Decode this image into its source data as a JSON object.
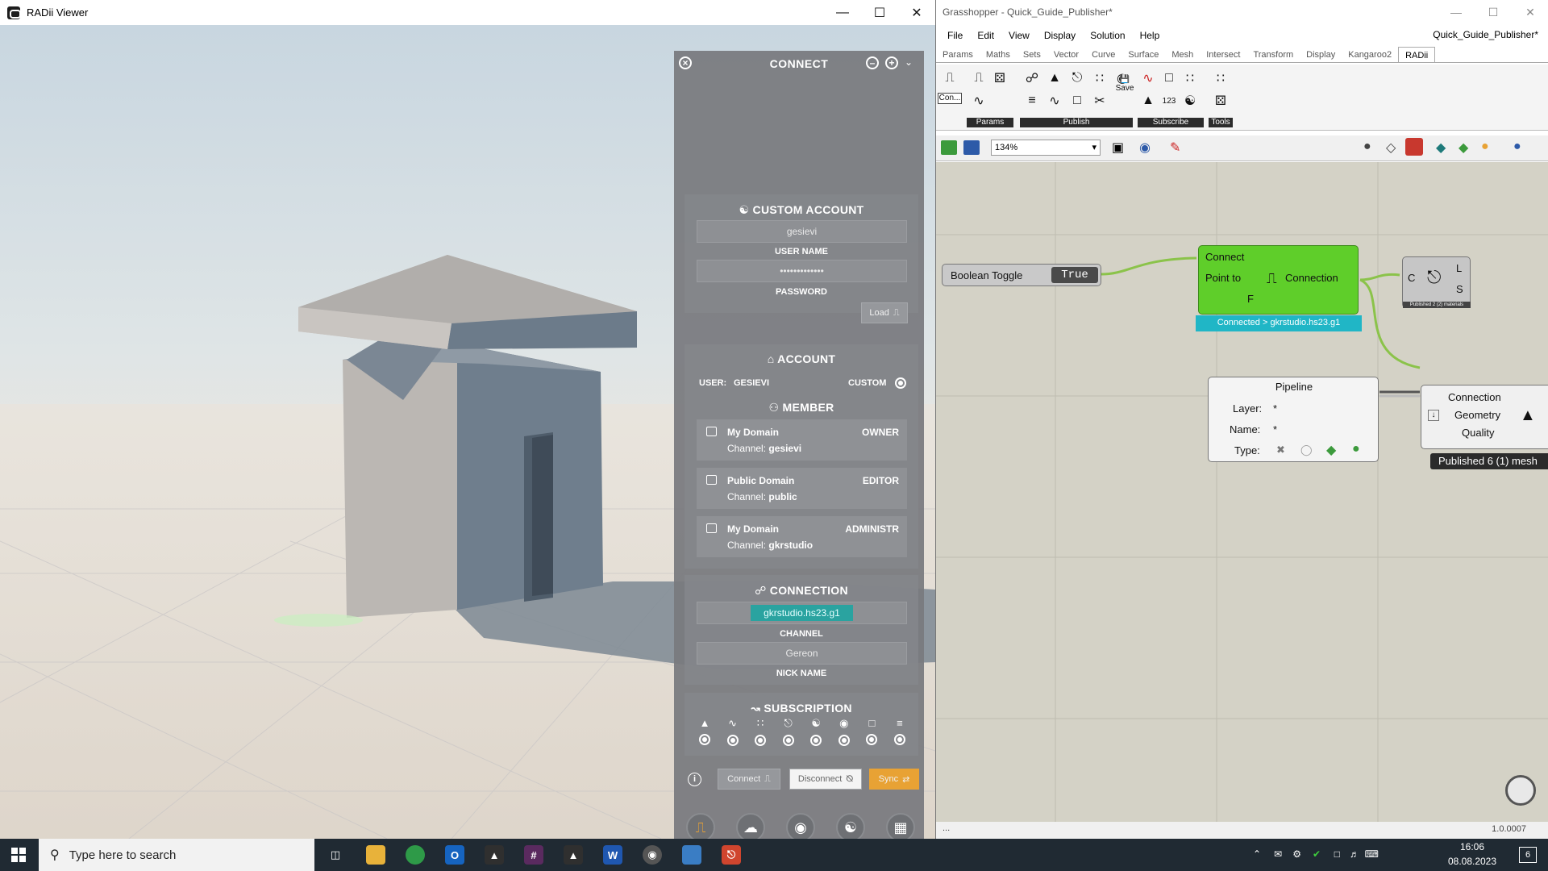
{
  "viewer": {
    "title": "RADii Viewer",
    "panel": {
      "title": "CONNECT",
      "custom_account": {
        "title": "CUSTOM ACCOUNT",
        "username_value": "gesievi",
        "username_label": "USER NAME",
        "password_value": "•••••••••••••",
        "password_label": "PASSWORD",
        "load_label": "Load"
      },
      "account": {
        "title": "ACCOUNT",
        "user_label": "USER:",
        "user_value": "GESIEVI",
        "mode": "CUSTOM"
      },
      "member": {
        "title": "MEMBER",
        "channel_label": "Channel:",
        "items": [
          {
            "domain": "My Domain",
            "role": "OWNER",
            "channel": "gesievi"
          },
          {
            "domain": "Public Domain",
            "role": "EDITOR",
            "channel": "public"
          },
          {
            "domain": "My Domain",
            "role": "ADMINISTR",
            "channel": "gkrstudio"
          }
        ]
      },
      "connection": {
        "title": "CONNECTION",
        "channel_value": "gkrstudio.hs23.g1",
        "channel_label": "CHANNEL",
        "nickname_value": "Gereon",
        "nickname_label": "NICK NAME"
      },
      "subscription": {
        "title": "SUBSCRIPTION",
        "icons": [
          "shapes-icon",
          "line-icon",
          "points-icon",
          "paint-roller-icon",
          "person-icon",
          "eye-icon",
          "comment-icon",
          "sliders-icon"
        ]
      },
      "actions": {
        "info": "i",
        "connect": "Connect",
        "disconnect": "Disconnect",
        "sync": "Sync"
      }
    }
  },
  "grasshopper": {
    "title": "Grasshopper - Quick_Guide_Publisher*",
    "document": "Quick_Guide_Publisher*",
    "menu": [
      "File",
      "Edit",
      "View",
      "Display",
      "Solution",
      "Help"
    ],
    "tabs": [
      "Params",
      "Maths",
      "Sets",
      "Vector",
      "Curve",
      "Surface",
      "Mesh",
      "Intersect",
      "Transform",
      "Display",
      "Kangaroo2",
      "RADii"
    ],
    "active_tab": "RADii",
    "ribbon_groups": [
      "Params",
      "Publish",
      "Subscribe",
      "Tools"
    ],
    "ribbon_con_label": "Con...",
    "ribbon_save_label": "Save",
    "zoom": "134%",
    "version": "1.0.0007",
    "status_left": "...",
    "nodes": {
      "toggle": {
        "label": "Boolean Toggle",
        "value": "True"
      },
      "connect": {
        "title": "Connect",
        "point_to": "Point to",
        "f": "F",
        "output": "Connection",
        "status": "Connected > gkrstudio.hs23.g1"
      },
      "paint": {
        "c": "C",
        "l": "L",
        "s": "S",
        "caption": "Published 2 (2) materials"
      },
      "pipeline": {
        "title": "Pipeline",
        "layer_label": "Layer:",
        "layer_value": "*",
        "name_label": "Name:",
        "name_value": "*",
        "type_label": "Type:"
      },
      "publish": {
        "connection": "Connection",
        "geometry": "Geometry",
        "quality": "Quality",
        "status": "Published 6 (1) mesh"
      }
    }
  },
  "taskbar": {
    "search_placeholder": "Type here to search",
    "time": "16:06",
    "date": "08.08.2023",
    "notifications": "6"
  }
}
